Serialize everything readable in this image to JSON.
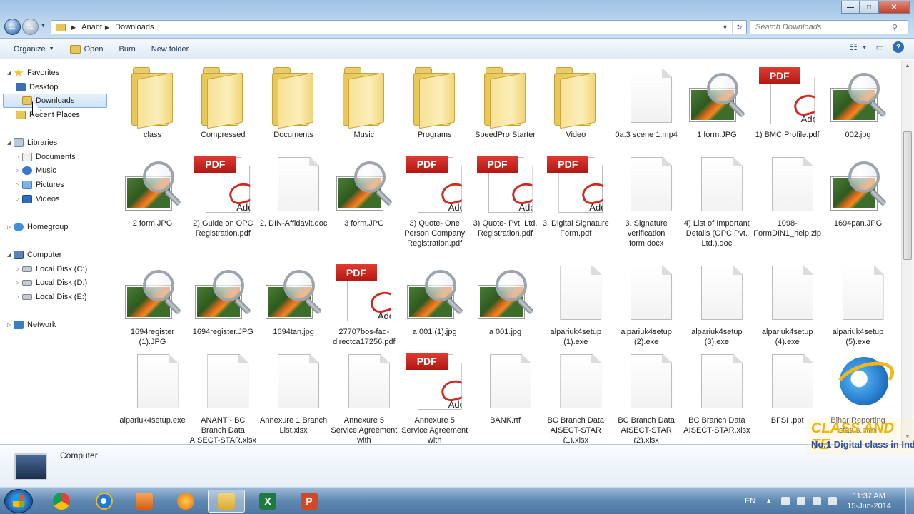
{
  "window": {
    "breadcrumb": [
      "Anant",
      "Downloads"
    ],
    "search_placeholder": "Search Downloads",
    "controls": {
      "minimize": "—",
      "maximize": "□",
      "close": "✕"
    }
  },
  "toolbar": {
    "organize": "Organize",
    "open": "Open",
    "burn": "Burn",
    "new_folder": "New folder"
  },
  "sidebar": {
    "favorites": "Favorites",
    "desktop": "Desktop",
    "downloads": "Downloads",
    "recent": "Recent Places",
    "libraries": "Libraries",
    "documents": "Documents",
    "music": "Music",
    "pictures": "Pictures",
    "videos": "Videos",
    "homegroup": "Homegroup",
    "computer": "Computer",
    "disk_c": "Local Disk (C:)",
    "disk_d": "Local Disk (D:)",
    "disk_e": "Local Disk (E:)",
    "network": "Network"
  },
  "files": [
    {
      "name": "class",
      "type": "folder"
    },
    {
      "name": "Compressed",
      "type": "folder"
    },
    {
      "name": "Documents",
      "type": "folder"
    },
    {
      "name": "Music",
      "type": "folder"
    },
    {
      "name": "Programs",
      "type": "folder"
    },
    {
      "name": "SpeedPro Starter",
      "type": "folder"
    },
    {
      "name": "Video",
      "type": "folder"
    },
    {
      "name": "0a.3 scene 1.mp4",
      "type": "file"
    },
    {
      "name": "1 form.JPG",
      "type": "image"
    },
    {
      "name": "1) BMC Profile.pdf",
      "type": "pdf"
    },
    {
      "name": "002.jpg",
      "type": "image"
    },
    {
      "name": "2 form.JPG",
      "type": "image"
    },
    {
      "name": "2) Guide on OPC Registration.pdf",
      "type": "pdf"
    },
    {
      "name": "2. DIN-Affidavit.doc",
      "type": "file"
    },
    {
      "name": "3 form.JPG",
      "type": "image"
    },
    {
      "name": "3) Quote- One Person Company Registration.pdf",
      "type": "pdf"
    },
    {
      "name": "3) Quote- Pvt. Ltd. Registration.pdf",
      "type": "pdf"
    },
    {
      "name": "3. Digital Signature Form.pdf",
      "type": "pdf"
    },
    {
      "name": "3. Signature verification form.docx",
      "type": "file"
    },
    {
      "name": "4) List of Important Details (OPC Pvt. Ltd.).doc",
      "type": "file"
    },
    {
      "name": "1098-FormDIN1_help.zip",
      "type": "file"
    },
    {
      "name": "1694pan.JPG",
      "type": "image"
    },
    {
      "name": "1694register (1).JPG",
      "type": "image"
    },
    {
      "name": "1694register.JPG",
      "type": "image"
    },
    {
      "name": "1694tan.jpg",
      "type": "image"
    },
    {
      "name": "27707bos-faq-directca17256.pdf",
      "type": "pdf"
    },
    {
      "name": "a 001 (1).jpg",
      "type": "image"
    },
    {
      "name": "a 001.jpg",
      "type": "image"
    },
    {
      "name": "alpariuk4setup (1).exe",
      "type": "file"
    },
    {
      "name": "alpariuk4setup (2).exe",
      "type": "file"
    },
    {
      "name": "alpariuk4setup (3).exe",
      "type": "file"
    },
    {
      "name": "alpariuk4setup (4).exe",
      "type": "file"
    },
    {
      "name": "alpariuk4setup (5).exe",
      "type": "file"
    },
    {
      "name": "alpariuk4setup.exe",
      "type": "file"
    },
    {
      "name": "ANANT - BC Branch Data AISECT-STAR.xlsx",
      "type": "file"
    },
    {
      "name": "Annexure 1 Branch List.xlsx",
      "type": "file"
    },
    {
      "name": "Annexure 5 Service Agreement with",
      "type": "file"
    },
    {
      "name": "Annexure 5 Service Agreement with",
      "type": "pdf"
    },
    {
      "name": "BANK.rtf",
      "type": "file"
    },
    {
      "name": "BC Branch Data AISECT-STAR (1).xlsx",
      "type": "file"
    },
    {
      "name": "BC Branch Data AISECT-STAR (2).xlsx",
      "type": "file"
    },
    {
      "name": "BC Branch Data AISECT-STAR.xlsx",
      "type": "file"
    },
    {
      "name": "BFSI .ppt",
      "type": "file"
    },
    {
      "name": "Bihar Reporting status.html",
      "type": "ie"
    }
  ],
  "details": {
    "title": "Computer"
  },
  "watermark": {
    "line1": "CLASS AND TE",
    "line2": "No.1 Digital class in Ind"
  },
  "taskbar": {
    "lang": "EN",
    "time": "11:37 AM",
    "date": "15-Jun-2014",
    "excel_letter": "X",
    "ppt_letter": "P"
  }
}
